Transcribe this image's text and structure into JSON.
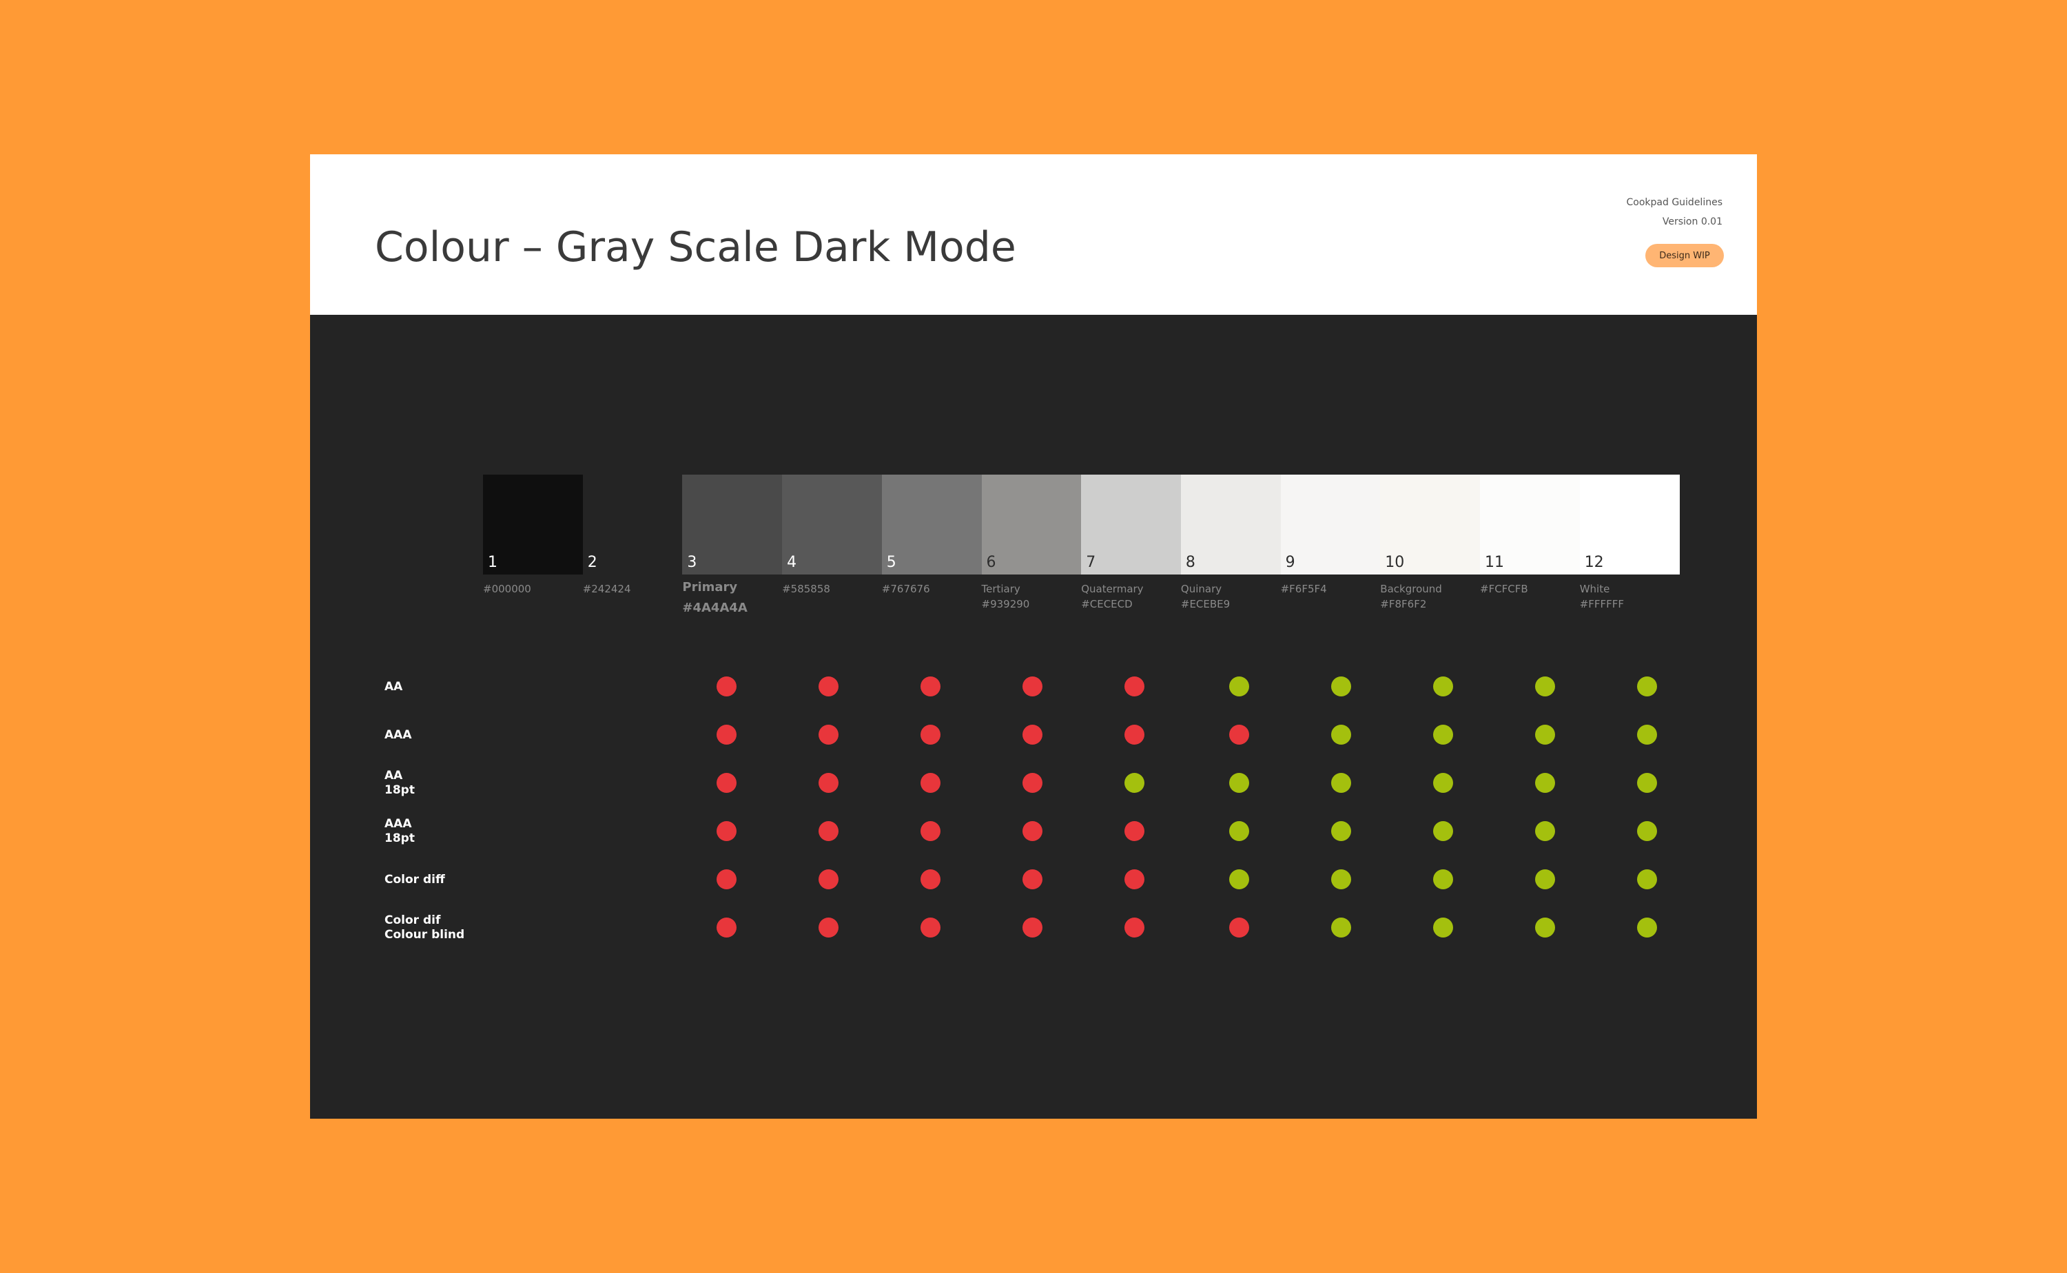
{
  "header": {
    "title": "Colour – Gray Scale Dark Mode",
    "brand": "Cookpad Guidelines",
    "version": "Version 0.01",
    "badge": "Design WIP"
  },
  "colors": {
    "page_background": "#FF9A35",
    "header_background": "#FFFFFF",
    "body_background": "#242424",
    "pass": "#A4C00E",
    "fail": "#E8363B",
    "badge": "#FFB573"
  },
  "swatches": [
    {
      "number": "1",
      "color": "#000000",
      "name": "",
      "hex": "#000000"
    },
    {
      "number": "2",
      "color": "#242424",
      "name": "",
      "hex": "#242424"
    },
    {
      "number": "3",
      "color": "#4A4A4A",
      "name": "Primary",
      "hex": "#4A4A4A"
    },
    {
      "number": "4",
      "color": "#585858",
      "name": "",
      "hex": "#585858"
    },
    {
      "number": "5",
      "color": "#767676",
      "name": "",
      "hex": "#767676"
    },
    {
      "number": "6",
      "color": "#939290",
      "name": "Tertiary",
      "hex": "#939290"
    },
    {
      "number": "7",
      "color": "#CECECD",
      "name": "Quatermary",
      "hex": "#CECECD"
    },
    {
      "number": "8",
      "color": "#ECEBE9",
      "name": "Quinary",
      "hex": "#ECEBE9"
    },
    {
      "number": "9",
      "color": "#F6F5F4",
      "name": "",
      "hex": "#F6F5F4"
    },
    {
      "number": "10",
      "color": "#F8F6F2",
      "name": "Background",
      "hex": "#F8F6F2"
    },
    {
      "number": "11",
      "color": "#FCFCFB",
      "name": "",
      "hex": "#FCFCFB"
    },
    {
      "number": "12",
      "color": "#FFFFFF",
      "name": "White",
      "hex": "#FFFFFF"
    }
  ],
  "matrix": {
    "columns": [
      "3",
      "4",
      "5",
      "6",
      "7",
      "8",
      "9",
      "10",
      "11",
      "12"
    ],
    "rows": [
      {
        "label": "AA",
        "results": [
          "fail",
          "fail",
          "fail",
          "fail",
          "fail",
          "pass",
          "pass",
          "pass",
          "pass",
          "pass"
        ]
      },
      {
        "label": "AAA",
        "results": [
          "fail",
          "fail",
          "fail",
          "fail",
          "fail",
          "fail",
          "pass",
          "pass",
          "pass",
          "pass"
        ]
      },
      {
        "label": "AA\n18pt",
        "results": [
          "fail",
          "fail",
          "fail",
          "fail",
          "pass",
          "pass",
          "pass",
          "pass",
          "pass",
          "pass"
        ]
      },
      {
        "label": "AAA\n18pt",
        "results": [
          "fail",
          "fail",
          "fail",
          "fail",
          "fail",
          "pass",
          "pass",
          "pass",
          "pass",
          "pass"
        ]
      },
      {
        "label": "Color diff",
        "results": [
          "fail",
          "fail",
          "fail",
          "fail",
          "fail",
          "pass",
          "pass",
          "pass",
          "pass",
          "pass"
        ]
      },
      {
        "label": "Color dif\nColour blind",
        "results": [
          "fail",
          "fail",
          "fail",
          "fail",
          "fail",
          "fail",
          "pass",
          "pass",
          "pass",
          "pass"
        ]
      }
    ]
  }
}
